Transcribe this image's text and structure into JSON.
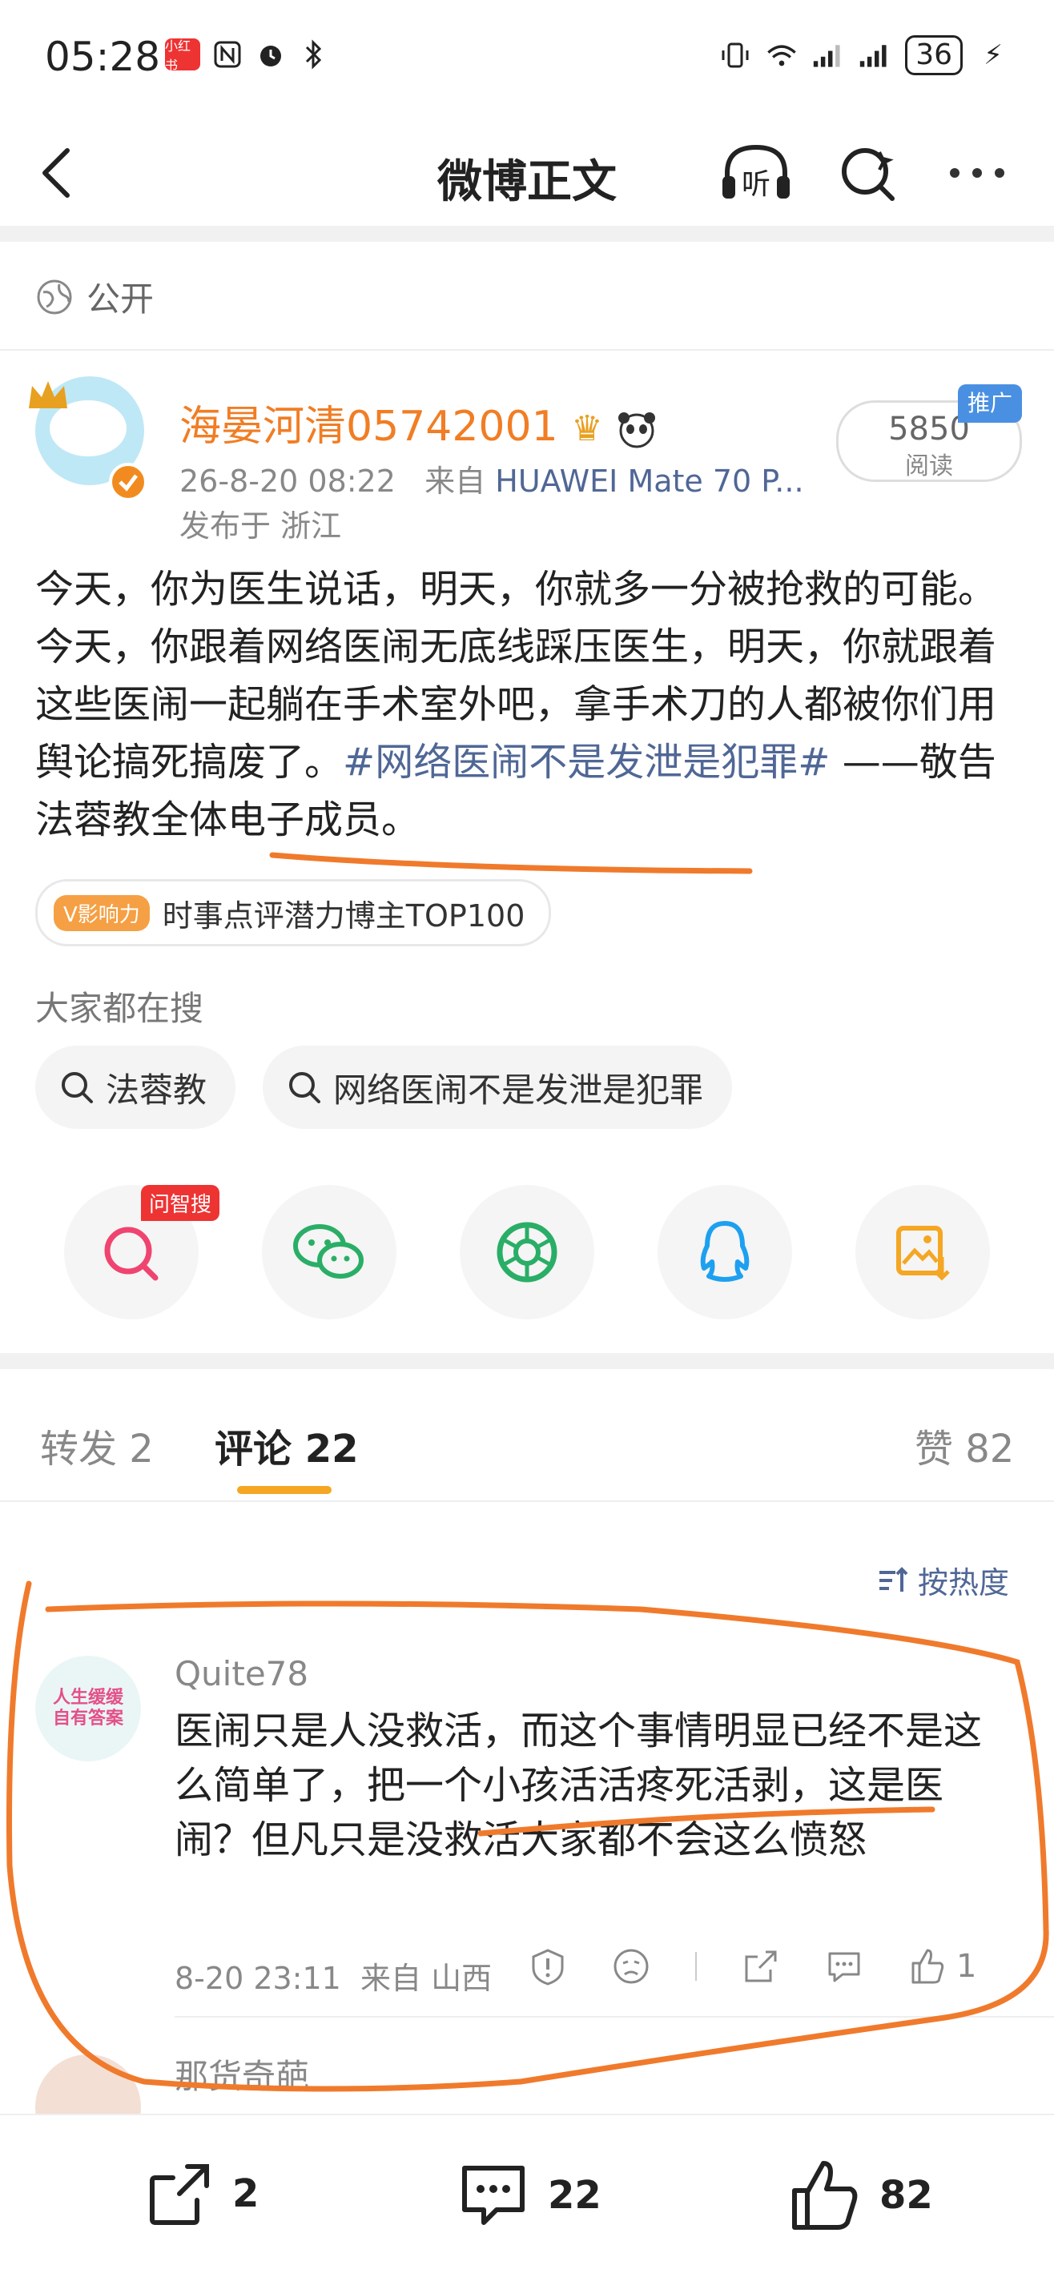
{
  "status_bar": {
    "time": "05:28",
    "badge": "小红书",
    "signal": "6",
    "battery": "36"
  },
  "nav": {
    "title": "微博正文",
    "listen_label": "听"
  },
  "visibility": "公开",
  "author": {
    "name": "海晏河清05742001",
    "time": "26-8-20 08:22",
    "source_prefix": "来自",
    "source": "HUAWEI Mate 70 P...",
    "location": "发布于 浙江",
    "read_count": "5850",
    "read_label": "阅读",
    "promo_badge": "推广"
  },
  "post": {
    "text": "今天，你为医生说话，明天，你就多一分被抢救的可能。今天，你跟着网络医闹无底线踩压医生，明天，你就跟着这些医闹一起躺在手术室外吧，拿手术刀的人都被你们用舆论搞死搞废了。",
    "hashtag": "#网络医闹不是发泄是犯罪#",
    "suffix": " ——敬告法蓉教全体电子成员。"
  },
  "influence": {
    "tag": "V影响力",
    "text": "时事点评潜力博主TOP100"
  },
  "search": {
    "heading": "大家都在搜",
    "chips": [
      "法蓉教",
      "网络医闹不是发泄是犯罪"
    ]
  },
  "share": {
    "ai_badge": "问智搜"
  },
  "tabs": {
    "repost": "转发 2",
    "comment": "评论 22",
    "like": "赞 82"
  },
  "sort_label": "按热度",
  "comments": [
    {
      "avatar_text": "人生缓缓自有答案",
      "name": "Quite78",
      "text": "医闹只是人没救活，而这个事情明显已经不是这么简单了，把一个小孩活活疼死活剥，这是医闹？但凡只是没救活大家都不会这么愤怒",
      "time": "8-20 23:11",
      "location": "来自 山西",
      "likes": "1"
    },
    {
      "name": "那货奇葩"
    }
  ],
  "bottom_bar": {
    "repost": "2",
    "comment": "22",
    "like": "82"
  },
  "colors": {
    "author_name": "#f17d24",
    "hashtag": "#506796",
    "tab_underline": "#f5a623",
    "annotation": "#f07a2c"
  }
}
